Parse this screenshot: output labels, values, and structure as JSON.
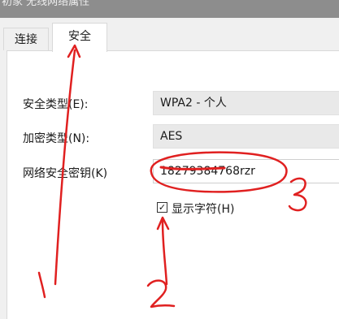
{
  "window": {
    "title": "初家 无线网络属性"
  },
  "tabs": [
    {
      "label": "连接",
      "active": false
    },
    {
      "label": "安全",
      "active": true
    }
  ],
  "form": {
    "security_type_label": "安全类型(E):",
    "security_type_value": "WPA2 - 个人",
    "encryption_type_label": "加密类型(N):",
    "encryption_type_value": "AES",
    "network_key_label": "网络安全密钥(K)",
    "network_key_value": "18279384768rzr",
    "show_characters_label": "显示字符(H)",
    "show_characters_checked": "✓"
  },
  "annotations": {
    "step1": "1",
    "step2": "2",
    "step3": "3",
    "color": "#e02020"
  }
}
